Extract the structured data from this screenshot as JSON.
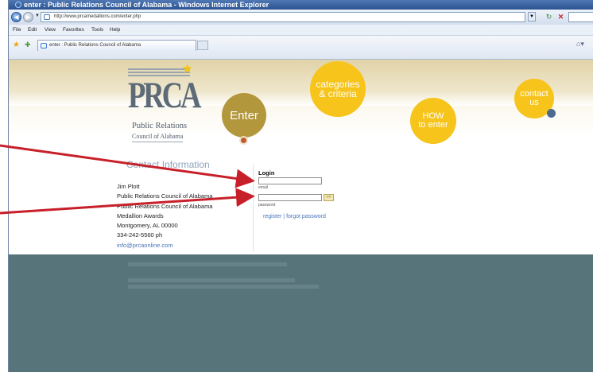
{
  "window": {
    "title": "enter : Public Relations Council of Alabama - Windows Internet Explorer"
  },
  "toolbar": {
    "url": "http://www.prcamedallions.com/enter.php",
    "menu": [
      "File",
      "Edit",
      "View",
      "Favorites",
      "Tools",
      "Help"
    ],
    "tab_label": "enter : Public Relations Council of Alabama"
  },
  "logo": {
    "text": "PRCA",
    "subtitle_line1": "Public Relations",
    "subtitle_line2": "Council of Alabama"
  },
  "nav": {
    "enter": "Enter",
    "categories_line1": "categories",
    "categories_line2": "& criteria",
    "how_line1": "HOW",
    "how_line2": "to enter",
    "contact_line1": "contact",
    "contact_line2": "us"
  },
  "contact": {
    "heading": "Contact Information",
    "lines": [
      "Jim Plott",
      "Public Relations Council of Alabama",
      "Public Relations Council of Alabama",
      "Medallion Awards",
      "Montgomery, AL 00000",
      "334-242-5560 ph"
    ],
    "email": "info@prcaonline.com"
  },
  "login": {
    "heading": "Login",
    "email_label": "email",
    "password_label": "password",
    "go_label": ">>",
    "register_link": "register",
    "separator": "|",
    "forgot_link": "forgot password"
  },
  "colors": {
    "gold": "#b2973c",
    "yellow": "#f6c41b",
    "footer": "#58747b",
    "arrow": "#c8202a"
  }
}
